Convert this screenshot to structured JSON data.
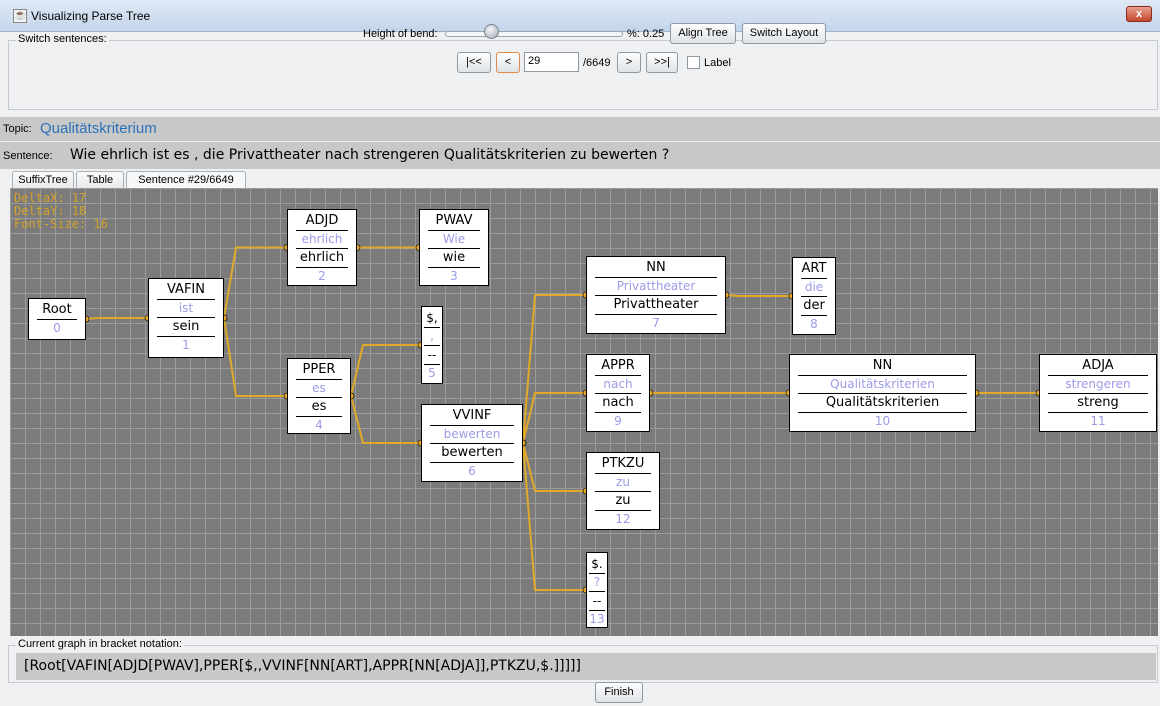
{
  "window": {
    "title": "Visualizing Parse Tree",
    "close_glyph": "x"
  },
  "switch_sentences": {
    "legend": "Switch sentences:",
    "height_label": "Height of bend:",
    "bend_value_label": "%: 0.25",
    "bend_value": 0.25,
    "align_tree": "Align Tree",
    "switch_layout": "Switch Layout",
    "first": "|<<",
    "prev": "<",
    "sentence_index": "29",
    "total": "/6649",
    "next": ">",
    "last": ">>|",
    "label_checkbox": "Label",
    "label_checked": false
  },
  "topic": {
    "key": "Topic:",
    "value": "Qualitätskriterium"
  },
  "sentence": {
    "key": "Sentence:",
    "value": "Wie ehrlich ist es , die Privattheater nach strengeren Qualitätskriterien zu bewerten ?"
  },
  "tabs": [
    "SuffixTree",
    "Table",
    "Sentence #29/6649"
  ],
  "debug": {
    "dx": "DeltaX: 17",
    "dy": "DeltaY: 18",
    "font": "Font-Size: 16"
  },
  "nodes": [
    {
      "id": 0,
      "tag": "Root",
      "word": "",
      "lemma": "",
      "idx": "0"
    },
    {
      "id": 1,
      "tag": "VAFIN",
      "word": "ist",
      "lemma": "sein",
      "idx": "1"
    },
    {
      "id": 2,
      "tag": "ADJD",
      "word": "ehrlich",
      "lemma": "ehrlich",
      "idx": "2"
    },
    {
      "id": 3,
      "tag": "PWAV",
      "word": "Wie",
      "lemma": "wie",
      "idx": "3"
    },
    {
      "id": 4,
      "tag": "PPER",
      "word": "es",
      "lemma": "es",
      "idx": "4"
    },
    {
      "id": 5,
      "tag": "$,",
      "word": ",",
      "lemma": "--",
      "idx": "5"
    },
    {
      "id": 6,
      "tag": "VVINF",
      "word": "bewerten",
      "lemma": "bewerten",
      "idx": "6"
    },
    {
      "id": 7,
      "tag": "NN",
      "word": "Privattheater",
      "lemma": "Privattheater",
      "idx": "7"
    },
    {
      "id": 8,
      "tag": "ART",
      "word": "die",
      "lemma": "der",
      "idx": "8"
    },
    {
      "id": 9,
      "tag": "APPR",
      "word": "nach",
      "lemma": "nach",
      "idx": "9"
    },
    {
      "id": 10,
      "tag": "NN",
      "word": "Qualitätskriterien",
      "lemma": "Qualitätskriterien",
      "idx": "10"
    },
    {
      "id": 11,
      "tag": "ADJA",
      "word": "strengeren",
      "lemma": "streng",
      "idx": "11"
    },
    {
      "id": 12,
      "tag": "PTKZU",
      "word": "zu",
      "lemma": "zu",
      "idx": "12"
    },
    {
      "id": 13,
      "tag": "$.",
      "word": "?",
      "lemma": "--",
      "idx": "13"
    }
  ],
  "edges": [
    [
      0,
      1
    ],
    [
      1,
      2
    ],
    [
      2,
      3
    ],
    [
      1,
      4
    ],
    [
      4,
      5
    ],
    [
      4,
      6
    ],
    [
      6,
      7
    ],
    [
      7,
      8
    ],
    [
      6,
      9
    ],
    [
      9,
      10
    ],
    [
      10,
      11
    ],
    [
      6,
      12
    ],
    [
      6,
      13
    ]
  ],
  "colors": {
    "edge": "#e0a92a",
    "canvas": "#7b7b7b",
    "topic_text": "#2c72b8",
    "node_word": "#9b9be8"
  },
  "bracket": {
    "legend": "Current graph in bracket notation:",
    "value": "[Root[VAFIN[ADJD[PWAV],PPER[$,,VVINF[NN[ART],APPR[NN[ADJA]],PTKZU,$.]]]]]"
  },
  "finish": "Finish"
}
